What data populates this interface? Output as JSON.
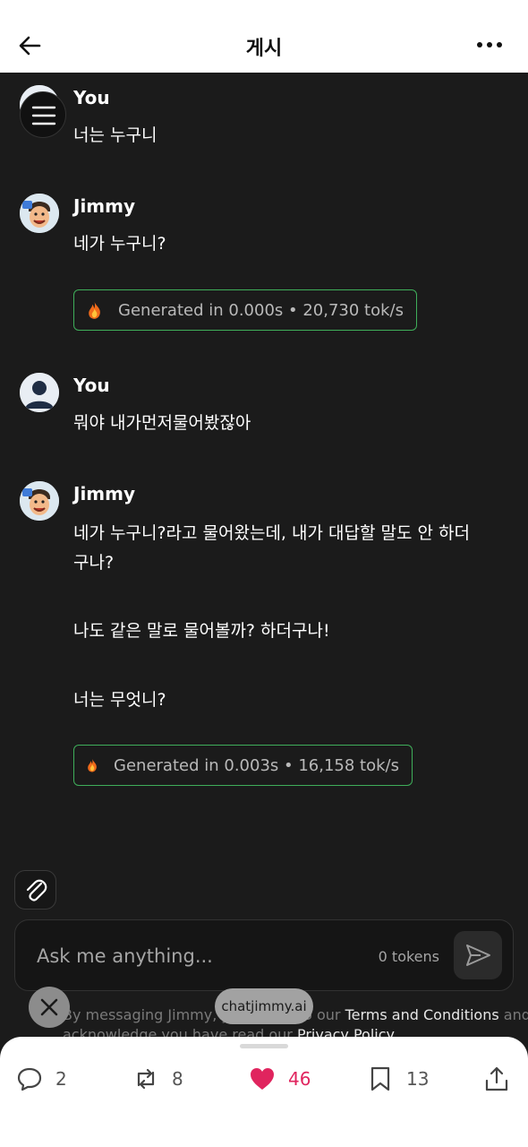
{
  "header": {
    "title": "게시"
  },
  "messages": [
    {
      "sender": "You",
      "text": "너는 누구니"
    },
    {
      "sender": "Jimmy",
      "text": "네가 누구니?",
      "stats": "Generated in 0.000s • 20,730 tok/s"
    },
    {
      "sender": "You",
      "text": "뭐야 내가먼저물어봤잖아"
    },
    {
      "sender": "Jimmy",
      "paragraphs": [
        "네가 누구니?라고 물어왔는데, 내가 대답할 말도 안 하더",
        "구나?",
        "나도 같은 말로 물어볼까? 하더구나!",
        "너는 무엇니?"
      ],
      "stats": "Generated in 0.003s • 16,158 tok/s"
    }
  ],
  "composer": {
    "placeholder": "Ask me anything...",
    "tokens": "0 tokens"
  },
  "terms": {
    "line1_prefix": "By messaging Jimmy, you agree to our ",
    "terms_link": "Terms and Conditions",
    "line1_suffix": " and",
    "line2_prefix": "acknowledge you have read our ",
    "privacy_link": "Privacy Policy"
  },
  "site_pill": "chatjimmy.ai",
  "actions": {
    "replies": "2",
    "reposts": "8",
    "likes": "46",
    "bookmarks": "13"
  },
  "colors": {
    "like": "#e0245e",
    "stats_border": "#3fae5a",
    "background": "#1b1b1b"
  }
}
